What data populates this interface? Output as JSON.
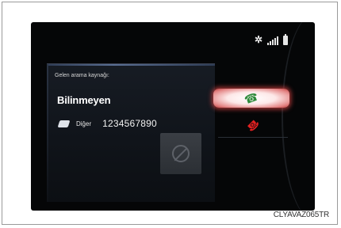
{
  "status_bar": {
    "bluetooth_icon": "bluetooth-icon",
    "signal_icon": "signal-strength-icon",
    "battery_icon": "battery-icon"
  },
  "call": {
    "incoming_label": "Gelen arama kaynağı:",
    "caller_name": "Bilinmeyen",
    "phone_type": "Diğer",
    "phone_number": "1234567890"
  },
  "buttons": {
    "answer_icon": "phone-answer-icon",
    "decline_icon": "phone-decline-icon",
    "mute_icon": "mute-disabled-icon"
  },
  "colors": {
    "answer_glow": "#e48686",
    "answer_icon": "#2e8a3a",
    "decline_icon": "#e22121"
  },
  "footer": {
    "image_code": "CLYAVAZ065TR"
  }
}
